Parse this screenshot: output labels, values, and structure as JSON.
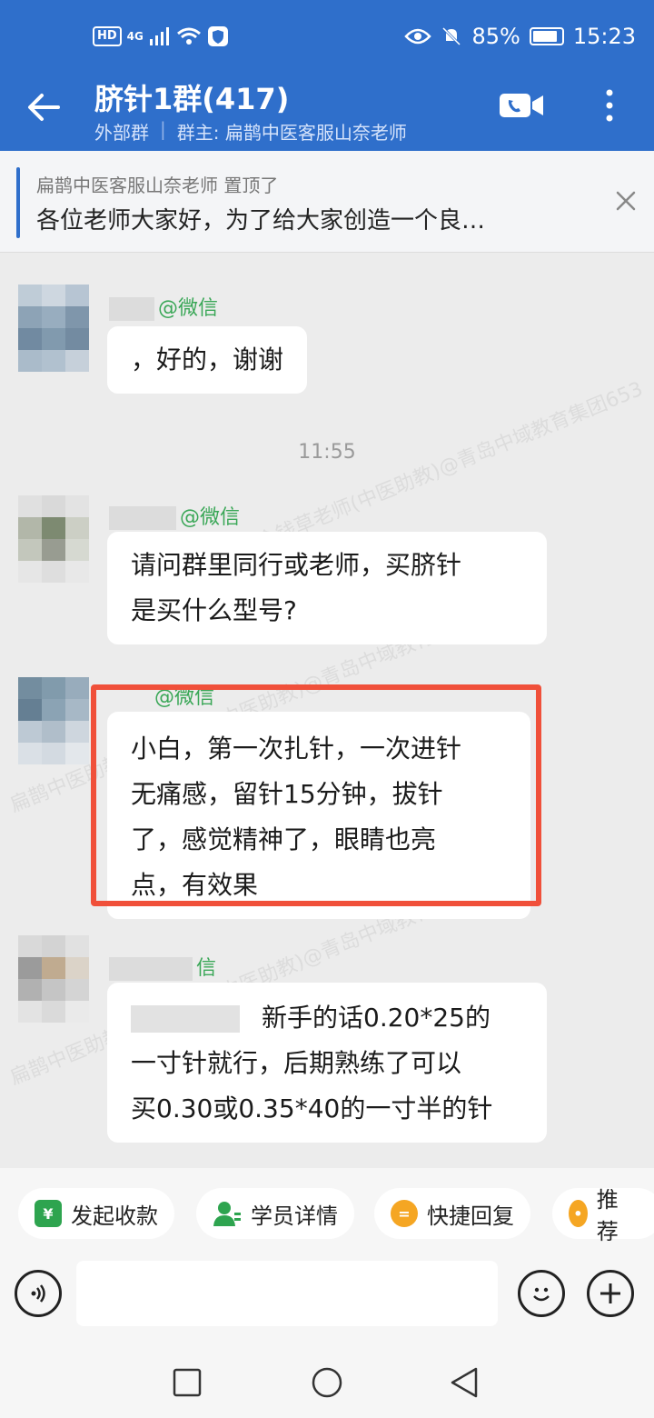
{
  "status_bar": {
    "network": "4G",
    "hd": "HD",
    "battery": "85%",
    "time": "15:23"
  },
  "header": {
    "title": "脐针1群(417)",
    "tag": "外部群",
    "owner": "群主: 扁鹊中医客服山奈老师"
  },
  "pinned": {
    "author_line": "扁鹊中医客服山奈老师 置顶了",
    "text": "各位老师大家好，为了给大家创造一个良…"
  },
  "messages": [
    {
      "sender_suffix": "@微信",
      "text": "，好的，谢谢"
    },
    {
      "time": "11:55"
    },
    {
      "sender_suffix": "@微信",
      "lines": [
        "请问群里同行或老师，买脐针",
        "是买什么型号?"
      ]
    },
    {
      "sender_suffix": "@微信",
      "lines": [
        "小白，第一次扎针，一次进针",
        "无痛感，留针15分钟，拔针",
        "了，感觉精神了，眼睛也亮",
        "点，有效果"
      ]
    },
    {
      "sender_suffix": "信",
      "lines": [
        "新手的话0.20*25的",
        "一寸针就行，后期熟练了可以",
        "买0.30或0.35*40的一寸半的针"
      ]
    }
  ],
  "watermark": "扁鹊中医助教金钱草老师(中医助教)@青岛中域教育集团653",
  "quick_actions": [
    {
      "label": "发起收款",
      "icon": "yuan-icon",
      "color": "#2ea44f"
    },
    {
      "label": "学员详情",
      "icon": "user-icon",
      "color": "#2ea44f"
    },
    {
      "label": "快捷回复",
      "icon": "chat-icon",
      "color": "#f5a623"
    },
    {
      "label": "推荐",
      "icon": "recommend-icon",
      "color": "#f5a623"
    }
  ],
  "colors": {
    "accent": "#2f6fcb",
    "highlight": "#f0503a",
    "wechat_green": "#3aa757"
  }
}
